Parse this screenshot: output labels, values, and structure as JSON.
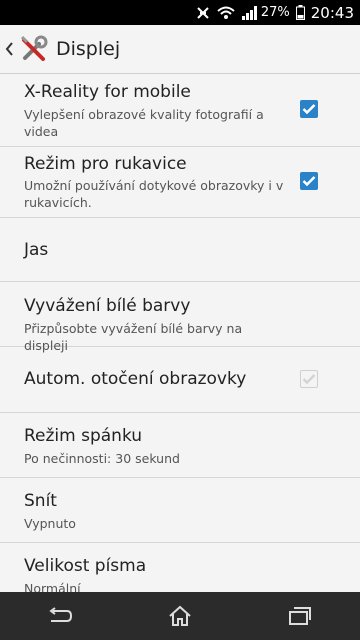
{
  "status": {
    "battery_pct": "27%",
    "time": "20:43"
  },
  "header": {
    "title": "Displej"
  },
  "settings": [
    {
      "title": "X-Reality for mobile",
      "subtitle": "Vylepšení obrazové kvality fotografií a videa"
    },
    {
      "title": "Režim pro rukavice",
      "subtitle": "Umožní používání dotykové obrazovky i v rukavicích."
    },
    {
      "title": "Jas"
    },
    {
      "title": "Vyvážení bílé barvy",
      "subtitle": "Přizpůsobte vyvážení bílé barvy na displeji"
    },
    {
      "title": "Autom. otočení obrazovky"
    },
    {
      "title": "Režim spánku",
      "subtitle": "Po nečinnosti: 30 sekund"
    },
    {
      "title": "Snít",
      "subtitle": "Vypnuto"
    },
    {
      "title": "Velikost písma",
      "subtitle": "Normální"
    }
  ],
  "checkboxes": {
    "x_reality": "checked",
    "glove_mode": "checked",
    "auto_rotate": "checked-disabled"
  },
  "colors": {
    "accent": "#2a82c9",
    "navbar": "#2b2b2b",
    "statusbar": "#000000"
  }
}
